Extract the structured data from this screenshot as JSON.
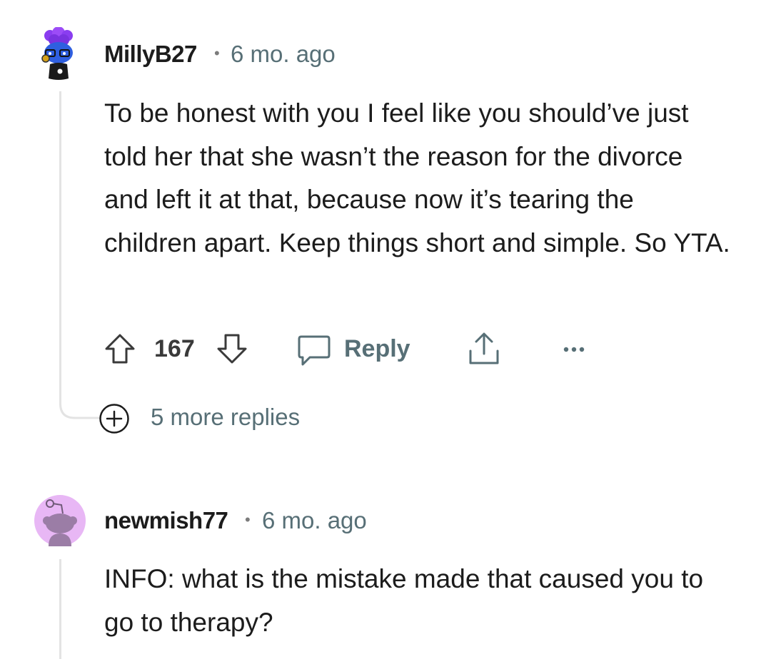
{
  "comments": [
    {
      "username": "MillyB27",
      "separator": "•",
      "time_ago": "6 mo. ago",
      "body": "To be honest with you I feel like you should’ve just told her that she wasn’t the reason for the divorce and left it at that, because now it’s tearing the children apart. Keep things short and simple. So YTA.",
      "score": "167",
      "reply_label": "Reply",
      "more_replies_label": "5 more replies"
    },
    {
      "username": "newmish77",
      "separator": "•",
      "time_ago": "6 mo. ago",
      "body": "INFO: what is the mistake made that caused you to go to therapy?"
    }
  ],
  "icons": {
    "upvote": "arrow-up-icon",
    "downvote": "arrow-down-icon",
    "reply": "speech-bubble-icon",
    "share": "share-icon",
    "overflow": "more-horizontal-icon",
    "expand": "plus-circle-icon"
  },
  "colors": {
    "avatar1_bg": "#ffffff",
    "avatar1_hair": "#8a3df0",
    "avatar1_face": "#2f5fe0",
    "avatar2_bg": "#e8b7f5",
    "avatar2_snoo": "#9b7da6",
    "meta_gray": "#576f76",
    "thread_line": "#e3e3e3"
  }
}
